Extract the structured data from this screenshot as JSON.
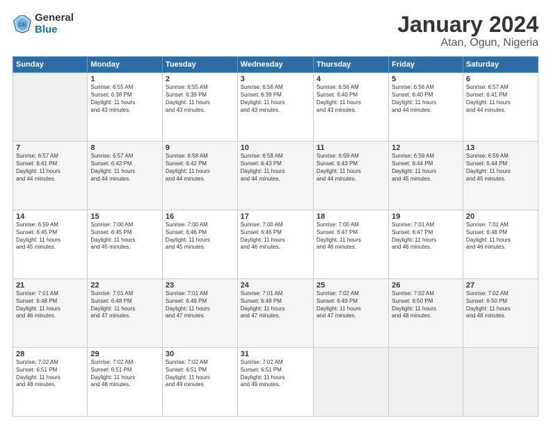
{
  "logo": {
    "general": "General",
    "blue": "Blue"
  },
  "title": "January 2024",
  "subtitle": "Atan, Ogun, Nigeria",
  "days_of_week": [
    "Sunday",
    "Monday",
    "Tuesday",
    "Wednesday",
    "Thursday",
    "Friday",
    "Saturday"
  ],
  "weeks": [
    [
      {
        "day": "",
        "info": ""
      },
      {
        "day": "1",
        "info": "Sunrise: 6:55 AM\nSunset: 6:38 PM\nDaylight: 11 hours\nand 43 minutes."
      },
      {
        "day": "2",
        "info": "Sunrise: 6:55 AM\nSunset: 6:39 PM\nDaylight: 11 hours\nand 43 minutes."
      },
      {
        "day": "3",
        "info": "Sunrise: 6:56 AM\nSunset: 6:39 PM\nDaylight: 11 hours\nand 43 minutes."
      },
      {
        "day": "4",
        "info": "Sunrise: 6:56 AM\nSunset: 6:40 PM\nDaylight: 11 hours\nand 43 minutes."
      },
      {
        "day": "5",
        "info": "Sunrise: 6:56 AM\nSunset: 6:40 PM\nDaylight: 11 hours\nand 44 minutes."
      },
      {
        "day": "6",
        "info": "Sunrise: 6:57 AM\nSunset: 6:41 PM\nDaylight: 11 hours\nand 44 minutes."
      }
    ],
    [
      {
        "day": "7",
        "info": "Sunrise: 6:57 AM\nSunset: 6:41 PM\nDaylight: 11 hours\nand 44 minutes."
      },
      {
        "day": "8",
        "info": "Sunrise: 6:57 AM\nSunset: 6:42 PM\nDaylight: 11 hours\nand 44 minutes."
      },
      {
        "day": "9",
        "info": "Sunrise: 6:58 AM\nSunset: 6:42 PM\nDaylight: 11 hours\nand 44 minutes."
      },
      {
        "day": "10",
        "info": "Sunrise: 6:58 AM\nSunset: 6:43 PM\nDaylight: 11 hours\nand 44 minutes."
      },
      {
        "day": "11",
        "info": "Sunrise: 6:59 AM\nSunset: 6:43 PM\nDaylight: 11 hours\nand 44 minutes."
      },
      {
        "day": "12",
        "info": "Sunrise: 6:59 AM\nSunset: 6:44 PM\nDaylight: 11 hours\nand 45 minutes."
      },
      {
        "day": "13",
        "info": "Sunrise: 6:59 AM\nSunset: 6:44 PM\nDaylight: 11 hours\nand 45 minutes."
      }
    ],
    [
      {
        "day": "14",
        "info": "Sunrise: 6:59 AM\nSunset: 6:45 PM\nDaylight: 11 hours\nand 45 minutes."
      },
      {
        "day": "15",
        "info": "Sunrise: 7:00 AM\nSunset: 6:45 PM\nDaylight: 11 hours\nand 45 minutes."
      },
      {
        "day": "16",
        "info": "Sunrise: 7:00 AM\nSunset: 6:46 PM\nDaylight: 11 hours\nand 45 minutes."
      },
      {
        "day": "17",
        "info": "Sunrise: 7:00 AM\nSunset: 6:46 PM\nDaylight: 11 hours\nand 46 minutes."
      },
      {
        "day": "18",
        "info": "Sunrise: 7:00 AM\nSunset: 6:47 PM\nDaylight: 11 hours\nand 46 minutes."
      },
      {
        "day": "19",
        "info": "Sunrise: 7:01 AM\nSunset: 6:47 PM\nDaylight: 11 hours\nand 46 minutes."
      },
      {
        "day": "20",
        "info": "Sunrise: 7:01 AM\nSunset: 6:48 PM\nDaylight: 11 hours\nand 46 minutes."
      }
    ],
    [
      {
        "day": "21",
        "info": "Sunrise: 7:01 AM\nSunset: 6:48 PM\nDaylight: 11 hours\nand 46 minutes."
      },
      {
        "day": "22",
        "info": "Sunrise: 7:01 AM\nSunset: 6:48 PM\nDaylight: 11 hours\nand 47 minutes."
      },
      {
        "day": "23",
        "info": "Sunrise: 7:01 AM\nSunset: 6:49 PM\nDaylight: 11 hours\nand 47 minutes."
      },
      {
        "day": "24",
        "info": "Sunrise: 7:01 AM\nSunset: 6:49 PM\nDaylight: 11 hours\nand 47 minutes."
      },
      {
        "day": "25",
        "info": "Sunrise: 7:02 AM\nSunset: 6:49 PM\nDaylight: 11 hours\nand 47 minutes."
      },
      {
        "day": "26",
        "info": "Sunrise: 7:02 AM\nSunset: 6:50 PM\nDaylight: 11 hours\nand 48 minutes."
      },
      {
        "day": "27",
        "info": "Sunrise: 7:02 AM\nSunset: 6:50 PM\nDaylight: 11 hours\nand 48 minutes."
      }
    ],
    [
      {
        "day": "28",
        "info": "Sunrise: 7:02 AM\nSunset: 6:51 PM\nDaylight: 11 hours\nand 48 minutes."
      },
      {
        "day": "29",
        "info": "Sunrise: 7:02 AM\nSunset: 6:51 PM\nDaylight: 11 hours\nand 48 minutes."
      },
      {
        "day": "30",
        "info": "Sunrise: 7:02 AM\nSunset: 6:51 PM\nDaylight: 11 hours\nand 49 minutes."
      },
      {
        "day": "31",
        "info": "Sunrise: 7:02 AM\nSunset: 6:51 PM\nDaylight: 11 hours\nand 49 minutes."
      },
      {
        "day": "",
        "info": ""
      },
      {
        "day": "",
        "info": ""
      },
      {
        "day": "",
        "info": ""
      }
    ]
  ]
}
